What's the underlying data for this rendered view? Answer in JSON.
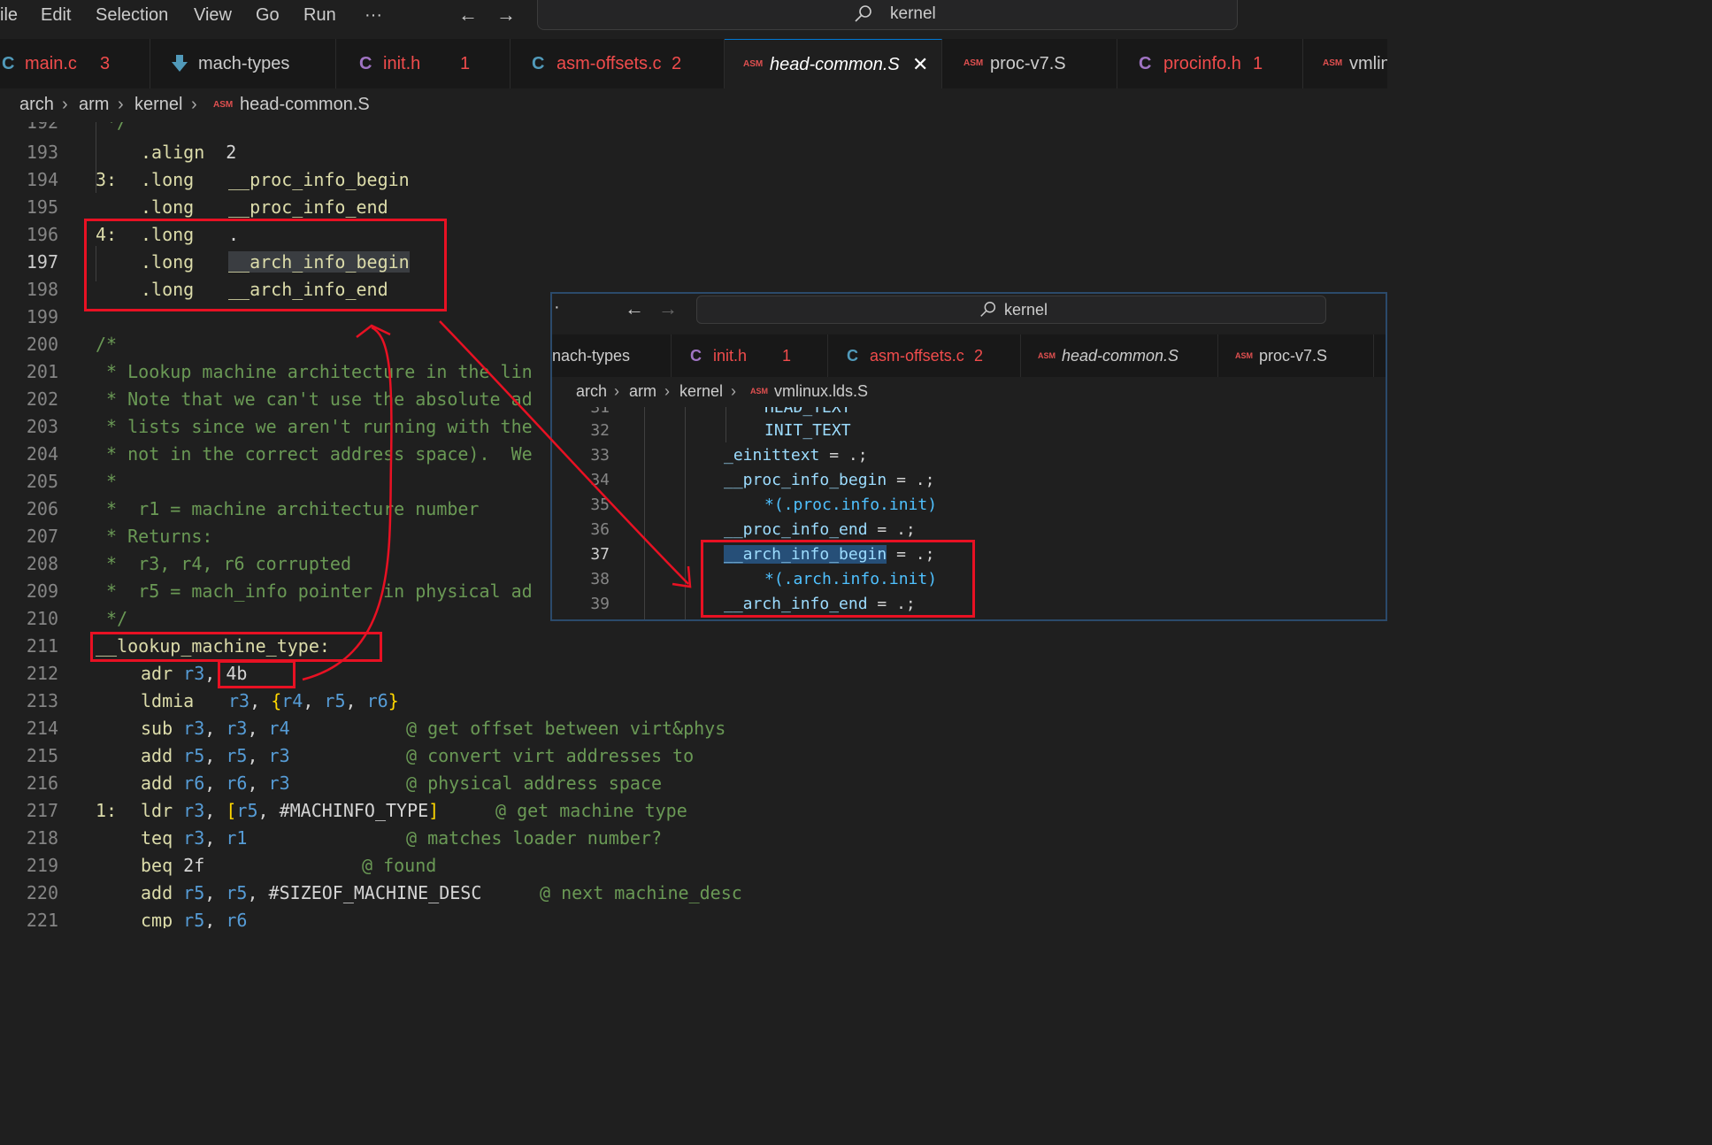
{
  "menu": {
    "items": [
      "ile",
      "Edit",
      "Selection",
      "View",
      "Go",
      "Run",
      "···"
    ],
    "back": "←",
    "forward": "→",
    "search_text": "kernel"
  },
  "tabs": [
    {
      "icon": "C",
      "name": "main.c",
      "badge": "3"
    },
    {
      "icon": "download",
      "name": "mach-types",
      "badge": ""
    },
    {
      "icon": "C",
      "name": "init.h",
      "badge": "1"
    },
    {
      "icon": "C",
      "name": "asm-offsets.c",
      "badge": "2"
    },
    {
      "icon": "ASM",
      "name": "head-common.S",
      "badge": "",
      "close": "✕"
    },
    {
      "icon": "ASM",
      "name": "proc-v7.S",
      "badge": ""
    },
    {
      "icon": "C",
      "name": "procinfo.h",
      "badge": "1"
    },
    {
      "icon": "ASM",
      "name": "vmlin",
      "badge": ""
    }
  ],
  "breadcrumb": {
    "parts": [
      "arch",
      "arm",
      "kernel"
    ],
    "file": "head-common.S",
    "sep": "›",
    "asm": "ASM"
  },
  "editor": {
    "line_numbers": [
      "192",
      "193",
      "194",
      "195",
      "196",
      "197",
      "198",
      "199",
      "200",
      "201",
      "202",
      "203",
      "204",
      "205",
      "206",
      "207",
      "208",
      "209",
      "210",
      "211",
      "212",
      "213",
      "214",
      "215",
      "216",
      "217",
      "218",
      "219",
      "220",
      "221"
    ],
    "lines": {
      "l192": "*/",
      "l193a": ".align",
      "l193b": "2",
      "l194a": "3:",
      "l194b": ".long",
      "l194c": "__proc_info_begin",
      "l195b": ".long",
      "l195c": "__proc_info_end",
      "l196a": "4:",
      "l196b": ".long",
      "l196c": ".",
      "l197b": ".long",
      "l197c": "__arch_info_begin",
      "l198b": ".long",
      "l198c": "__arch_info_end",
      "l200": "/*",
      "l201": " * Lookup machine architecture in the lin",
      "l202": " * Note that we can't use the absolute ad",
      "l203": " * lists since we aren't running with the",
      "l204": " * not in the correct address space).  We",
      "l205": " *",
      "l206": " *  r1 = machine architecture number",
      "l207": " * Returns:",
      "l208": " *  r3, r4, r6 corrupted",
      "l209": " *  r5 = mach_info pointer in physical ad",
      "l210": " */",
      "l211": "__lookup_machine_type:",
      "l212a": "adr",
      "l212b": "r3",
      "l212c": ", 4b",
      "l213a": "ldmia",
      "l213b": "r3",
      "l213c": ", ",
      "l213d": "{",
      "l213e": "r4",
      "l213f": "r5",
      "l213g": "r6",
      "l213h": "}",
      "l214a": "sub",
      "l214b": "r3",
      "l214c": "r3",
      "l214d": "r4",
      "l214e": "@ get offset between virt&phys",
      "l215a": "add",
      "l215b": "r5",
      "l215c": "r5",
      "l215d": "r3",
      "l215e": "@ convert virt addresses to",
      "l216a": "add",
      "l216b": "r6",
      "l216c": "r6",
      "l216d": "r3",
      "l216e": "@ physical address space",
      "l217a": "1:",
      "l217b": "ldr",
      "l217c": "r3",
      "l217d": "[",
      "l217e": "r5",
      "l217f": "#MACHINFO_TYPE",
      "l217g": "]",
      "l217h": "@ get machine type",
      "l218a": "teq",
      "l218b": "r3",
      "l218c": "r1",
      "l218d": "@ matches loader number?",
      "l219a": "beq",
      "l219b": "2f",
      "l219c": "@ found",
      "l220a": "add",
      "l220b": "r5",
      "l220c": "r5",
      "l220d": "#SIZEOF_MACHINE_DESC",
      "l220e": "@ next machine_desc",
      "l221a": "cmp",
      "l221b": "r5",
      "l221c": "r6"
    }
  },
  "popup": {
    "dot": "·",
    "back": "←",
    "forward": "→",
    "search_text": "kernel",
    "tabs": [
      {
        "icon": "",
        "name": "nach-types",
        "badge": ""
      },
      {
        "icon": "C",
        "name": "init.h",
        "badge": "1"
      },
      {
        "icon": "C",
        "name": "asm-offsets.c",
        "badge": "2"
      },
      {
        "icon": "ASM",
        "name": "head-common.S",
        "badge": ""
      },
      {
        "icon": "ASM",
        "name": "proc-v7.S",
        "badge": ""
      }
    ],
    "breadcrumb": {
      "parts": [
        "arch",
        "arm",
        "kernel"
      ],
      "file": "vmlinux.lds.S",
      "sep": "›",
      "asm": "ASM"
    },
    "line_numbers": [
      "31",
      "32",
      "33",
      "34",
      "35",
      "36",
      "37",
      "38",
      "39"
    ],
    "lines": {
      "p31": "HEAD_TEXT",
      "p32": "INIT_TEXT",
      "p33a": "_einittext",
      "p33b": " = .;",
      "p34a": "__proc_info_begin",
      "p34b": " = .;",
      "p35": "*(.proc.info.init)",
      "p36a": "__proc_info_end",
      "p36b": " = .;",
      "p37a": "__arch_info_begin",
      "p37b": " = .;",
      "p38": "*(.arch.info.init)",
      "p39a": "__arch_info_end",
      "p39b": " = .;"
    }
  }
}
